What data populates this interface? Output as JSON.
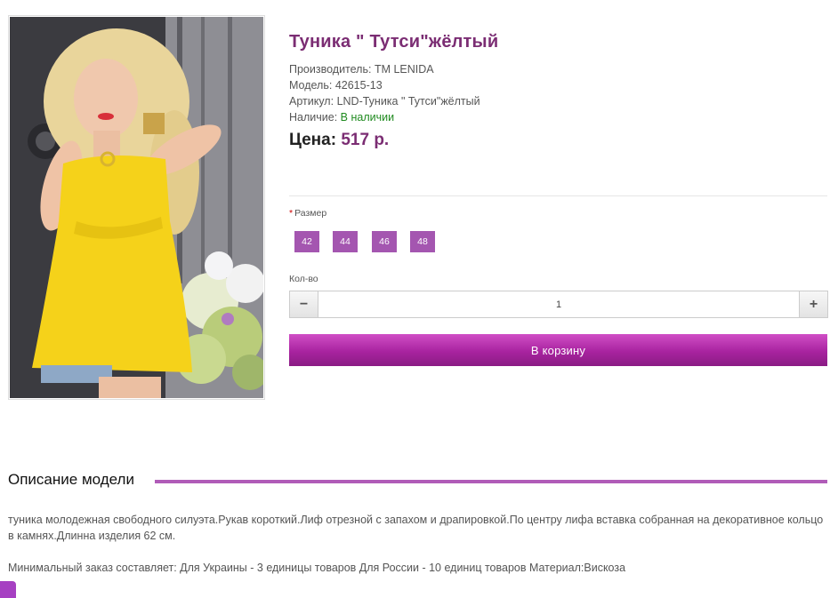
{
  "product": {
    "title": "Туника \" Тутси\"жёлтый",
    "manufacturer_label": "Производитель:",
    "manufacturer": "TM LENIDA",
    "model_label": "Модель:",
    "model": "42615-13",
    "sku_label": "Артикул:",
    "sku": "LND-Туника \" Тутси\"жёлтый",
    "availability_label": "Наличие:",
    "availability": "В наличии",
    "price_label": "Цена:",
    "price": "517 р."
  },
  "options": {
    "required_mark": "*",
    "size_label": "Размер",
    "sizes": [
      "42",
      "44",
      "46",
      "48"
    ],
    "qty_label": "Кол-во",
    "qty_value": "1",
    "minus": "−",
    "plus": "+"
  },
  "cart": {
    "button_label": "В корзину"
  },
  "description": {
    "heading": "Описание модели",
    "text": "туника молодежная свободного силуэта.Рукав короткий.Лиф отрезной с запахом и драпировкой.По центру лифа вставка собранная на декоративное кольцо в камнях.Длинна изделия 62 см.",
    "note": "Минимальный заказ составляет: Для Украины - 3 единицы товаров Для России - 10 единиц товаров Материал:Вискоза"
  },
  "colors": {
    "accent": "#7b2d73",
    "size_button": "#a456b0",
    "cart_button": "#b62aac",
    "in_stock": "#1f8a1f",
    "product": "#f5d21a"
  }
}
